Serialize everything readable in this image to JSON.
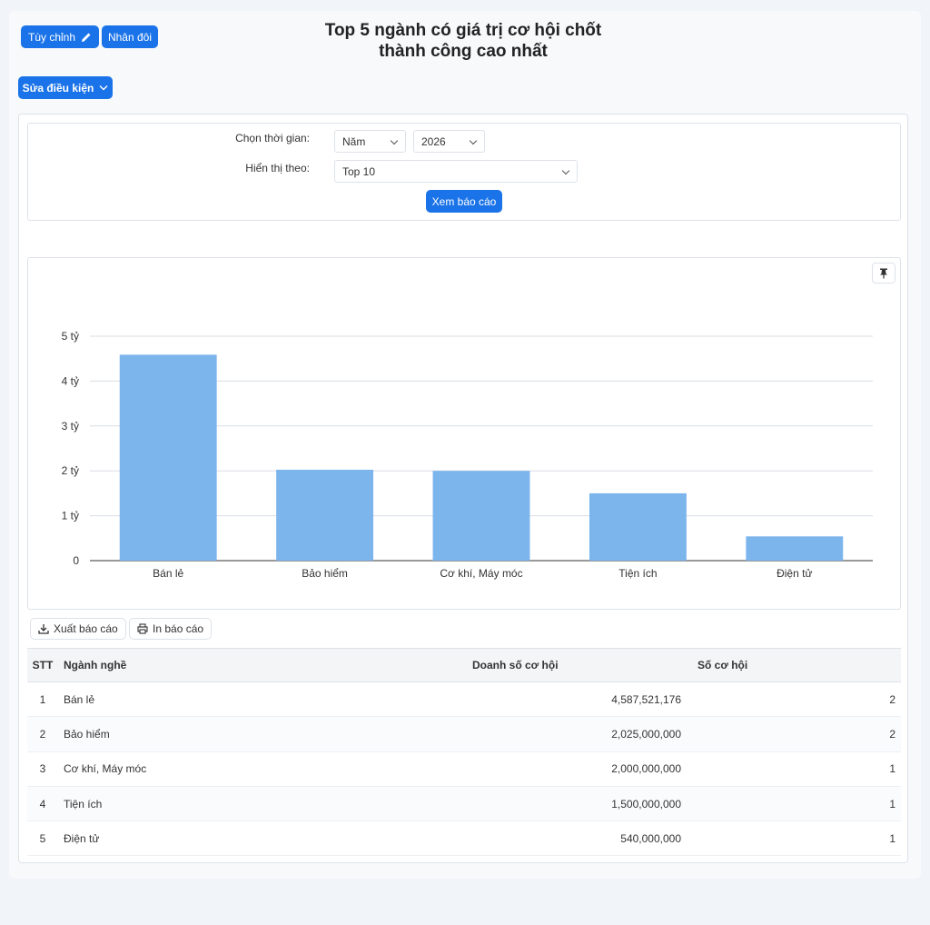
{
  "toolbar": {
    "customize_label": "Tùy chỉnh",
    "duplicate_label": "Nhân đôi",
    "edit_conditions_label": "Sửa điều kiện"
  },
  "title": {
    "line1": "Top 5 ngành có giá trị cơ hội chốt",
    "line2": "thành công cao nhất"
  },
  "filters": {
    "time_label": "Chọn thời gian:",
    "period_value": "Năm",
    "year_value": "2026",
    "display_label": "Hiển thị theo:",
    "display_value": "Top 10",
    "submit_label": "Xem báo cáo"
  },
  "actions": {
    "export_label": "Xuất báo cáo",
    "print_label": "In báo cáo"
  },
  "chart_data": {
    "type": "bar",
    "categories": [
      "Bán lẻ",
      "Bảo hiểm",
      "Cơ khí, Máy móc",
      "Tiện ích",
      "Điện tử"
    ],
    "values": [
      4587521176,
      2025000000,
      2000000000,
      1500000000,
      540000000
    ],
    "ylim": [
      0,
      5000000000
    ],
    "yticks": [
      0,
      1000000000,
      2000000000,
      3000000000,
      4000000000,
      5000000000
    ],
    "ytick_labels": [
      "0",
      "1 tỷ",
      "2 tỷ",
      "3 tỷ",
      "4 tỷ",
      "5 tỷ"
    ],
    "bar_color": "#7cb4ec",
    "grid": true
  },
  "table": {
    "headers": [
      "STT",
      "Ngành nghề",
      "Doanh số cơ hội",
      "Số cơ hội"
    ],
    "rows": [
      [
        "1",
        "Bán lẻ",
        "4,587,521,176",
        "2"
      ],
      [
        "2",
        "Bảo hiểm",
        "2,025,000,000",
        "2"
      ],
      [
        "3",
        "Cơ khí, Máy móc",
        "2,000,000,000",
        "1"
      ],
      [
        "4",
        "Tiện ích",
        "1,500,000,000",
        "1"
      ],
      [
        "5",
        "Điện tử",
        "540,000,000",
        "1"
      ]
    ]
  },
  "colors": {
    "accent": "#1a73e8",
    "bar": "#7cb4ec"
  }
}
